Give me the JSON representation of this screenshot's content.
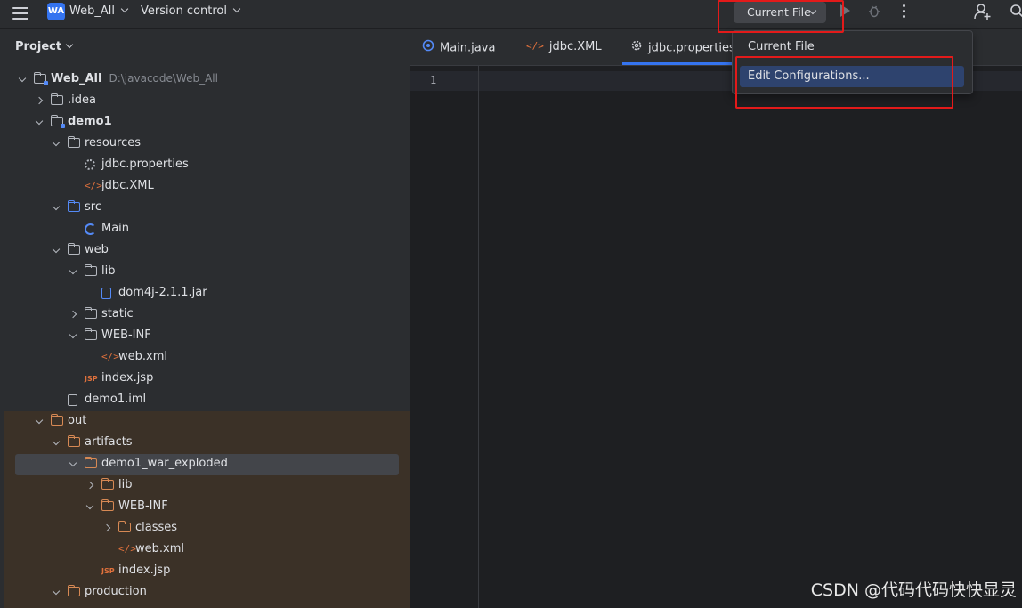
{
  "titlebar": {
    "project_badge": "WA",
    "project_name": "Web_All",
    "vcs_label": "Version control",
    "run_config": "Current File",
    "icons": [
      "hamburger-menu-icon",
      "run-icon",
      "debug-icon",
      "more-icon",
      "add-user-icon",
      "search-icon"
    ]
  },
  "project_panel": {
    "title": "Project",
    "tree": [
      {
        "label": "Web_All",
        "path": "D:\\javacode\\Web_All",
        "depth": 0,
        "arrow": "open",
        "icon": "module-folder",
        "bold": true
      },
      {
        "label": ".idea",
        "depth": 1,
        "arrow": "closed",
        "icon": "folder"
      },
      {
        "label": "demo1",
        "depth": 1,
        "arrow": "open",
        "icon": "module-folder",
        "bold": true
      },
      {
        "label": "resources",
        "depth": 2,
        "arrow": "open",
        "icon": "resources-folder"
      },
      {
        "label": "jdbc.properties",
        "depth": 3,
        "arrow": "none",
        "icon": "properties"
      },
      {
        "label": "jdbc.XML",
        "depth": 3,
        "arrow": "none",
        "icon": "xml"
      },
      {
        "label": "src",
        "depth": 2,
        "arrow": "open",
        "icon": "source-folder"
      },
      {
        "label": "Main",
        "depth": 3,
        "arrow": "none",
        "icon": "class"
      },
      {
        "label": "web",
        "depth": 2,
        "arrow": "open",
        "icon": "web-folder"
      },
      {
        "label": "lib",
        "depth": 3,
        "arrow": "open",
        "icon": "folder"
      },
      {
        "label": "dom4j-2.1.1.jar",
        "depth": 4,
        "arrow": "none",
        "icon": "jar"
      },
      {
        "label": "static",
        "depth": 3,
        "arrow": "closed",
        "icon": "folder"
      },
      {
        "label": "WEB-INF",
        "depth": 3,
        "arrow": "open",
        "icon": "folder"
      },
      {
        "label": "web.xml",
        "depth": 4,
        "arrow": "none",
        "icon": "xml"
      },
      {
        "label": "index.jsp",
        "depth": 3,
        "arrow": "none",
        "icon": "jsp"
      },
      {
        "label": "demo1.iml",
        "depth": 2,
        "arrow": "none",
        "icon": "iml"
      },
      {
        "label": "out",
        "depth": 1,
        "arrow": "open",
        "icon": "excluded-folder"
      },
      {
        "label": "artifacts",
        "depth": 2,
        "arrow": "open",
        "icon": "excluded-folder"
      },
      {
        "label": "demo1_war_exploded",
        "depth": 3,
        "arrow": "open",
        "icon": "excluded-folder",
        "selected": true
      },
      {
        "label": "lib",
        "depth": 4,
        "arrow": "closed",
        "icon": "excluded-folder"
      },
      {
        "label": "WEB-INF",
        "depth": 4,
        "arrow": "open",
        "icon": "excluded-folder"
      },
      {
        "label": "classes",
        "depth": 5,
        "arrow": "closed",
        "icon": "excluded-folder"
      },
      {
        "label": "web.xml",
        "depth": 5,
        "arrow": "none",
        "icon": "xml"
      },
      {
        "label": "index.jsp",
        "depth": 4,
        "arrow": "none",
        "icon": "jsp"
      },
      {
        "label": "production",
        "depth": 2,
        "arrow": "open",
        "icon": "excluded-folder"
      }
    ]
  },
  "editor": {
    "tabs": [
      {
        "label": "Main.java",
        "icon": "class-icon"
      },
      {
        "label": "jdbc.XML",
        "icon": "xml-icon"
      },
      {
        "label": "jdbc.properties",
        "icon": "properties-icon",
        "active": true
      }
    ],
    "line_number": "1"
  },
  "dropdown": {
    "items": [
      "Current File",
      "Edit Configurations..."
    ],
    "highlighted_index": 1
  },
  "watermark": "CSDN @代码代码快快显灵",
  "colors": {
    "accent": "#3574f0",
    "highlight": "#e31a1a",
    "excluded_bg": "#3b3127",
    "folder_orange": "#d78954"
  }
}
